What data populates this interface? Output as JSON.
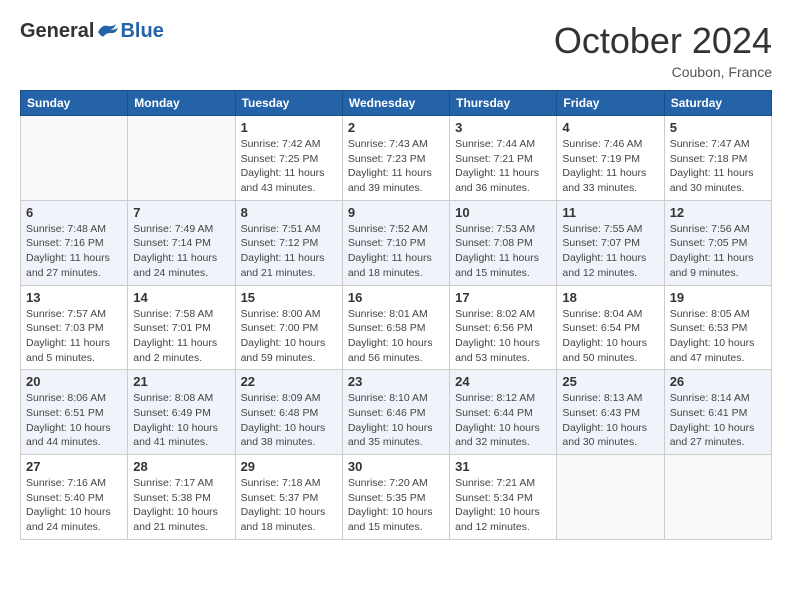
{
  "header": {
    "logo_general": "General",
    "logo_blue": "Blue",
    "month_title": "October 2024",
    "location": "Coubon, France"
  },
  "weekdays": [
    "Sunday",
    "Monday",
    "Tuesday",
    "Wednesday",
    "Thursday",
    "Friday",
    "Saturday"
  ],
  "weeks": [
    [
      {
        "day": "",
        "info": ""
      },
      {
        "day": "",
        "info": ""
      },
      {
        "day": "1",
        "info": "Sunrise: 7:42 AM\nSunset: 7:25 PM\nDaylight: 11 hours and 43 minutes."
      },
      {
        "day": "2",
        "info": "Sunrise: 7:43 AM\nSunset: 7:23 PM\nDaylight: 11 hours and 39 minutes."
      },
      {
        "day": "3",
        "info": "Sunrise: 7:44 AM\nSunset: 7:21 PM\nDaylight: 11 hours and 36 minutes."
      },
      {
        "day": "4",
        "info": "Sunrise: 7:46 AM\nSunset: 7:19 PM\nDaylight: 11 hours and 33 minutes."
      },
      {
        "day": "5",
        "info": "Sunrise: 7:47 AM\nSunset: 7:18 PM\nDaylight: 11 hours and 30 minutes."
      }
    ],
    [
      {
        "day": "6",
        "info": "Sunrise: 7:48 AM\nSunset: 7:16 PM\nDaylight: 11 hours and 27 minutes."
      },
      {
        "day": "7",
        "info": "Sunrise: 7:49 AM\nSunset: 7:14 PM\nDaylight: 11 hours and 24 minutes."
      },
      {
        "day": "8",
        "info": "Sunrise: 7:51 AM\nSunset: 7:12 PM\nDaylight: 11 hours and 21 minutes."
      },
      {
        "day": "9",
        "info": "Sunrise: 7:52 AM\nSunset: 7:10 PM\nDaylight: 11 hours and 18 minutes."
      },
      {
        "day": "10",
        "info": "Sunrise: 7:53 AM\nSunset: 7:08 PM\nDaylight: 11 hours and 15 minutes."
      },
      {
        "day": "11",
        "info": "Sunrise: 7:55 AM\nSunset: 7:07 PM\nDaylight: 11 hours and 12 minutes."
      },
      {
        "day": "12",
        "info": "Sunrise: 7:56 AM\nSunset: 7:05 PM\nDaylight: 11 hours and 9 minutes."
      }
    ],
    [
      {
        "day": "13",
        "info": "Sunrise: 7:57 AM\nSunset: 7:03 PM\nDaylight: 11 hours and 5 minutes."
      },
      {
        "day": "14",
        "info": "Sunrise: 7:58 AM\nSunset: 7:01 PM\nDaylight: 11 hours and 2 minutes."
      },
      {
        "day": "15",
        "info": "Sunrise: 8:00 AM\nSunset: 7:00 PM\nDaylight: 10 hours and 59 minutes."
      },
      {
        "day": "16",
        "info": "Sunrise: 8:01 AM\nSunset: 6:58 PM\nDaylight: 10 hours and 56 minutes."
      },
      {
        "day": "17",
        "info": "Sunrise: 8:02 AM\nSunset: 6:56 PM\nDaylight: 10 hours and 53 minutes."
      },
      {
        "day": "18",
        "info": "Sunrise: 8:04 AM\nSunset: 6:54 PM\nDaylight: 10 hours and 50 minutes."
      },
      {
        "day": "19",
        "info": "Sunrise: 8:05 AM\nSunset: 6:53 PM\nDaylight: 10 hours and 47 minutes."
      }
    ],
    [
      {
        "day": "20",
        "info": "Sunrise: 8:06 AM\nSunset: 6:51 PM\nDaylight: 10 hours and 44 minutes."
      },
      {
        "day": "21",
        "info": "Sunrise: 8:08 AM\nSunset: 6:49 PM\nDaylight: 10 hours and 41 minutes."
      },
      {
        "day": "22",
        "info": "Sunrise: 8:09 AM\nSunset: 6:48 PM\nDaylight: 10 hours and 38 minutes."
      },
      {
        "day": "23",
        "info": "Sunrise: 8:10 AM\nSunset: 6:46 PM\nDaylight: 10 hours and 35 minutes."
      },
      {
        "day": "24",
        "info": "Sunrise: 8:12 AM\nSunset: 6:44 PM\nDaylight: 10 hours and 32 minutes."
      },
      {
        "day": "25",
        "info": "Sunrise: 8:13 AM\nSunset: 6:43 PM\nDaylight: 10 hours and 30 minutes."
      },
      {
        "day": "26",
        "info": "Sunrise: 8:14 AM\nSunset: 6:41 PM\nDaylight: 10 hours and 27 minutes."
      }
    ],
    [
      {
        "day": "27",
        "info": "Sunrise: 7:16 AM\nSunset: 5:40 PM\nDaylight: 10 hours and 24 minutes."
      },
      {
        "day": "28",
        "info": "Sunrise: 7:17 AM\nSunset: 5:38 PM\nDaylight: 10 hours and 21 minutes."
      },
      {
        "day": "29",
        "info": "Sunrise: 7:18 AM\nSunset: 5:37 PM\nDaylight: 10 hours and 18 minutes."
      },
      {
        "day": "30",
        "info": "Sunrise: 7:20 AM\nSunset: 5:35 PM\nDaylight: 10 hours and 15 minutes."
      },
      {
        "day": "31",
        "info": "Sunrise: 7:21 AM\nSunset: 5:34 PM\nDaylight: 10 hours and 12 minutes."
      },
      {
        "day": "",
        "info": ""
      },
      {
        "day": "",
        "info": ""
      }
    ]
  ]
}
